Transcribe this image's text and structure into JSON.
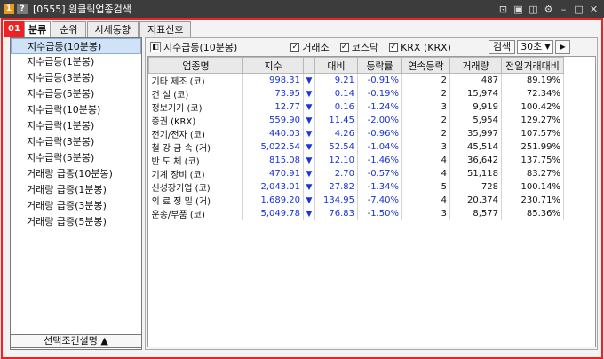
{
  "window": {
    "title": "[0555] 원클릭업종검색",
    "icon1": "1",
    "icon2": "?",
    "controls": [
      "⊡",
      "▣",
      "◫",
      "⚙",
      "–",
      "□",
      "✕"
    ]
  },
  "badge": "01",
  "tabs": [
    {
      "label": "분류"
    },
    {
      "label": "순위"
    },
    {
      "label": "시세동향"
    },
    {
      "label": "지표신호"
    }
  ],
  "left": {
    "items": [
      "지수급등(10분봉)",
      "지수급등(1분봉)",
      "지수급등(3분봉)",
      "지수급등(5분봉)",
      "지수급락(10분봉)",
      "지수급락(1분봉)",
      "지수급락(3분봉)",
      "지수급락(5분봉)",
      "거래량 급증(10분봉)",
      "거래량 급증(1분봉)",
      "거래량 급증(3분봉)",
      "거래량 급증(5분봉)"
    ],
    "footer": "선택조건설명 ▲"
  },
  "toolbar": {
    "title": "지수급등(10분봉)",
    "checks": [
      {
        "label": "거래소"
      },
      {
        "label": "코스닥"
      },
      {
        "label": "KRX (KRX)"
      }
    ],
    "search_label": "검색",
    "interval": "30초"
  },
  "table": {
    "headers": [
      "업종명",
      "지수",
      "",
      "대비",
      "등락률",
      "연속등락",
      "거래량",
      "전일거래대비"
    ],
    "rows": [
      {
        "name": "기타 제조 (코)",
        "index": "998.31",
        "arrow": "▼",
        "change": "9.21",
        "rate": "-0.91%",
        "streak": "2",
        "volume": "487",
        "prev": "89.19%"
      },
      {
        "name": "건    설 (코)",
        "index": "73.95",
        "arrow": "▼",
        "change": "0.14",
        "rate": "-0.19%",
        "streak": "2",
        "volume": "15,974",
        "prev": "72.34%"
      },
      {
        "name": "정보기기 (코)",
        "index": "12.77",
        "arrow": "▼",
        "change": "0.16",
        "rate": "-1.24%",
        "streak": "3",
        "volume": "9,919",
        "prev": "100.42%"
      },
      {
        "name": "증권 (KRX)",
        "index": "559.90",
        "arrow": "▼",
        "change": "11.45",
        "rate": "-2.00%",
        "streak": "2",
        "volume": "5,954",
        "prev": "129.27%"
      },
      {
        "name": "전기/전자 (코)",
        "index": "440.03",
        "arrow": "▼",
        "change": "4.26",
        "rate": "-0.96%",
        "streak": "2",
        "volume": "35,997",
        "prev": "107.57%"
      },
      {
        "name": "철 강 금 속 (거)",
        "index": "5,022.54",
        "arrow": "▼",
        "change": "52.54",
        "rate": "-1.04%",
        "streak": "3",
        "volume": "45,514",
        "prev": "251.99%"
      },
      {
        "name": "반 도 체 (코)",
        "index": "815.08",
        "arrow": "▼",
        "change": "12.10",
        "rate": "-1.46%",
        "streak": "4",
        "volume": "36,642",
        "prev": "137.75%"
      },
      {
        "name": "기계 장비 (코)",
        "index": "470.91",
        "arrow": "▼",
        "change": "2.70",
        "rate": "-0.57%",
        "streak": "4",
        "volume": "51,118",
        "prev": "83.27%"
      },
      {
        "name": "신성장기업 (코)",
        "index": "2,043.01",
        "arrow": "▼",
        "change": "27.82",
        "rate": "-1.34%",
        "streak": "5",
        "volume": "728",
        "prev": "100.14%"
      },
      {
        "name": "의 료 정 밀 (거)",
        "index": "1,689.20",
        "arrow": "▼",
        "change": "134.95",
        "rate": "-7.40%",
        "streak": "4",
        "volume": "20,374",
        "prev": "230.71%"
      },
      {
        "name": "운송/부품 (코)",
        "index": "5,049.78",
        "arrow": "▼",
        "change": "76.83",
        "rate": "-1.50%",
        "streak": "3",
        "volume": "8,577",
        "prev": "85.36%"
      }
    ]
  },
  "colors": {
    "frame": "#ee2222",
    "down": "#1733d9",
    "selected": "#cfe2f6"
  }
}
